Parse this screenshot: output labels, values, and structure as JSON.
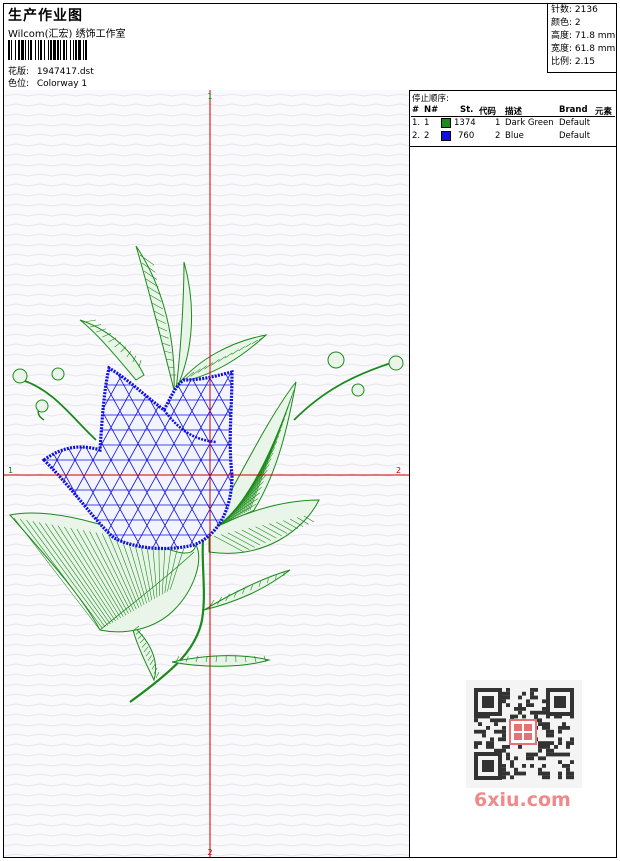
{
  "header": {
    "title": "生产作业图",
    "subtitle": "Wilcom(汇宏) 绣饰工作室",
    "design_label": "花版:",
    "design_value": "1947417.dst",
    "colorway_label": "色位:",
    "colorway_value": "Colorway 1"
  },
  "stats": {
    "stitches": "针数: 2136",
    "colors": "颜色: 2",
    "height": "高度: 71.8 mm",
    "width": "宽度: 61.8 mm",
    "scale": "比例: 2.15"
  },
  "axes": {
    "top": "1",
    "bottom": "2",
    "left": "1",
    "right": "2"
  },
  "stop_sequence": {
    "title": "停止顺序:",
    "headers": [
      "#",
      "N#",
      "St.",
      "代码",
      "描述",
      "Brand",
      "元素"
    ],
    "rows": [
      {
        "num": "1.",
        "n": "1",
        "stitches": "1374",
        "code": "1",
        "desc": "Dark Green",
        "brand": "Default",
        "color": "#1a8a1a"
      },
      {
        "num": "2.",
        "n": "2",
        "stitches": "760",
        "code": "2",
        "desc": "Blue",
        "brand": "Default",
        "color": "#1010e0"
      }
    ]
  },
  "watermark": {
    "text": "6xiu.com",
    "seal": "汉绣刺绣"
  },
  "colors": {
    "green": "#1a8a1a",
    "blue": "#1010e0",
    "axis": "#cc0000"
  }
}
